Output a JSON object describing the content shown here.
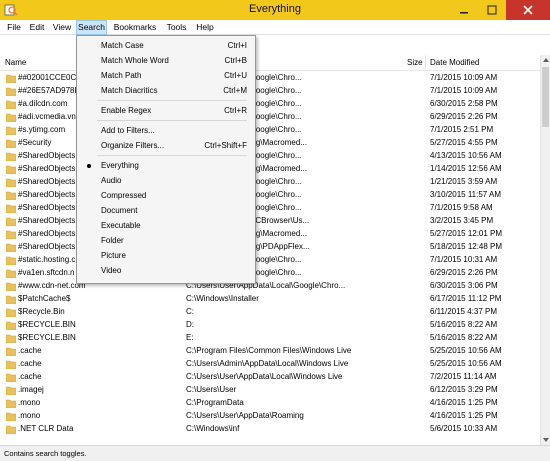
{
  "window": {
    "title": "Everything"
  },
  "menu": [
    {
      "label": "File"
    },
    {
      "label": "Edit"
    },
    {
      "label": "View"
    },
    {
      "label": "Search"
    },
    {
      "label": "Bookmarks"
    },
    {
      "label": "Tools"
    },
    {
      "label": "Help"
    }
  ],
  "columns": {
    "name": "Name",
    "size": "Size",
    "date": "Date Modified"
  },
  "rows": [
    {
      "name": "##02001CCE0C6",
      "path": "...\\AppData\\Local\\Google\\Chro...",
      "date": "7/1/2015 10:09 AM"
    },
    {
      "name": "##26E57AD978E",
      "path": "...\\AppData\\Local\\Google\\Chro...",
      "date": "7/1/2015 10:09 AM"
    },
    {
      "name": "#a.dilcdn.com",
      "path": "...\\AppData\\Local\\Google\\Chro...",
      "date": "6/30/2015 2:58 PM"
    },
    {
      "name": "#adi.vcmedia.vn",
      "path": "...\\AppData\\Local\\Google\\Chro...",
      "date": "6/29/2015 2:26 PM"
    },
    {
      "name": "#s.ytimg.com",
      "path": "...\\AppData\\Local\\Google\\Chro...",
      "date": "7/1/2015 2:51 PM"
    },
    {
      "name": "#Security",
      "path": "...\\AppData\\Roaming\\Macromed...",
      "date": "5/27/2015 4:55 PM"
    },
    {
      "name": "#SharedObjects",
      "path": "...\\AppData\\Local\\Google\\Chro...",
      "date": "4/13/2015 10:56 AM"
    },
    {
      "name": "#SharedObjects",
      "path": "...\\AppData\\Roaming\\Macromed...",
      "date": "1/14/2015 12:56 AM"
    },
    {
      "name": "#SharedObjects",
      "path": "...\\AppData\\Local\\Google\\Chro...",
      "date": "1/21/2015 3:59 AM"
    },
    {
      "name": "#SharedObjects",
      "path": "...\\AppData\\Local\\Google\\Chro...",
      "date": "3/10/2015 11:57 AM"
    },
    {
      "name": "#SharedObjects",
      "path": "...\\AppData\\Local\\Google\\Chro...",
      "date": "7/1/2015 9:58 AM"
    },
    {
      "name": "#SharedObjects",
      "path": "...\\AppData\\Local\\UCBrowser\\Us...",
      "date": "3/2/2015 3:45 PM"
    },
    {
      "name": "#SharedObjects",
      "path": "...\\AppData\\Roaming\\Macromed...",
      "date": "5/27/2015 12:01 PM"
    },
    {
      "name": "#SharedObjects",
      "path": "...\\AppData\\Roaming\\PDAppFlex...",
      "date": "5/18/2015 12:48 PM"
    },
    {
      "name": "#static.hosting.c",
      "path": "...\\AppData\\Local\\Google\\Chro...",
      "date": "7/1/2015 10:31 AM"
    },
    {
      "name": "#va1en.sftcdn.n",
      "path": "...\\AppData\\Local\\Google\\Chro...",
      "date": "6/29/2015 2:26 PM"
    },
    {
      "name": "#www.cdn-net.com",
      "path": "C:\\Users\\User\\AppData\\Local\\Google\\Chro...",
      "date": "6/30/2015 3:06 PM"
    },
    {
      "name": "$PatchCache$",
      "path": "C:\\Windows\\Installer",
      "date": "6/17/2015 11:12 PM"
    },
    {
      "name": "$Recycle.Bin",
      "path": "C:",
      "date": "6/11/2015 4:37 PM"
    },
    {
      "name": "$RECYCLE.BIN",
      "path": "D:",
      "date": "5/16/2015 8:22 AM"
    },
    {
      "name": "$RECYCLE.BIN",
      "path": "E:",
      "date": "5/16/2015 8:22 AM"
    },
    {
      "name": ".cache",
      "path": "C:\\Program Files\\Common Files\\Windows Live",
      "date": "5/25/2015 10:56 AM"
    },
    {
      "name": ".cache",
      "path": "C:\\Users\\Admin\\AppData\\Local\\Windows Live",
      "date": "5/25/2015 10:56 AM"
    },
    {
      "name": ".cache",
      "path": "C:\\Users\\User\\AppData\\Local\\Windows Live",
      "date": "7/2/2015 11:14 AM"
    },
    {
      "name": ".imagej",
      "path": "C:\\Users\\User",
      "date": "6/12/2015 3:29 PM"
    },
    {
      "name": ".mono",
      "path": "C:\\ProgramData",
      "date": "4/16/2015 1:25 PM"
    },
    {
      "name": ".mono",
      "path": "C:\\Users\\User\\AppData\\Roaming",
      "date": "4/16/2015 1:25 PM"
    },
    {
      "name": ".NET CLR Data",
      "path": "C:\\Windows\\inf",
      "date": "5/6/2015 10:33 AM"
    }
  ],
  "search_menu": {
    "items": [
      {
        "label": "Match Case",
        "shortcut": "Ctrl+I"
      },
      {
        "label": "Match Whole Word",
        "shortcut": "Ctrl+B"
      },
      {
        "label": "Match Path",
        "shortcut": "Ctrl+U"
      },
      {
        "label": "Match Diacritics",
        "shortcut": "Ctrl+M"
      },
      {
        "label": "Enable Regex",
        "shortcut": "Ctrl+R"
      },
      {
        "label": "Add to Filters...",
        "shortcut": ""
      },
      {
        "label": "Organize Filters...",
        "shortcut": "Ctrl+Shift+F"
      },
      {
        "label": "Everything",
        "shortcut": "",
        "selected": true
      },
      {
        "label": "Audio",
        "shortcut": ""
      },
      {
        "label": "Compressed",
        "shortcut": ""
      },
      {
        "label": "Document",
        "shortcut": ""
      },
      {
        "label": "Executable",
        "shortcut": ""
      },
      {
        "label": "Folder",
        "shortcut": ""
      },
      {
        "label": "Picture",
        "shortcut": ""
      },
      {
        "label": "Video",
        "shortcut": ""
      }
    ]
  },
  "status": {
    "text": "Contains search toggles."
  },
  "colors": {
    "titlebar": "#f2c81a",
    "close": "#c7342c",
    "menu_active": "#cce4f7",
    "folder": "#e8c15a"
  }
}
